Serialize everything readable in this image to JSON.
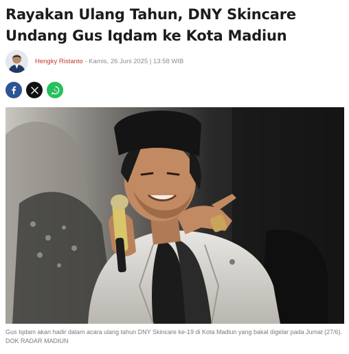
{
  "article": {
    "headline": "Rayakan Ulang Tahun, DNY Skincare Undang Gus Iqdam ke Kota Madiun",
    "author": "Hengky Ristanto",
    "date_separator": " - ",
    "date": "Kamis, 26 Juni 2025 | 13:58 WIB",
    "caption": "Gus Iqdam akan hadir dalam acara ulang tahun DNY Skincare ke-19 di Kota Madiun yang bakal digelar pada Jumat (27/6). DOK RADAR MADIUN"
  },
  "share": [
    {
      "network": "facebook",
      "icon": "facebook-icon",
      "color": "#2f5496"
    },
    {
      "network": "x",
      "icon": "x-icon",
      "color": "#111111"
    },
    {
      "network": "whatsapp",
      "icon": "whatsapp-icon",
      "color": "#25c05a"
    }
  ],
  "colors": {
    "author_link": "#c0392b",
    "meta_text": "#8b8b8b",
    "caption_text": "#7a7a7a"
  }
}
